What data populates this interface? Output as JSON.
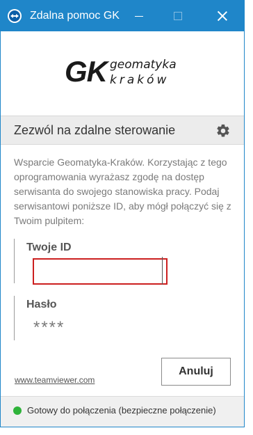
{
  "window": {
    "title": "Zdalna pomoc GK"
  },
  "logo": {
    "mark": "GK",
    "line1": "geomatyka",
    "line2": "kraków"
  },
  "header": {
    "title": "Zezwól na zdalne sterowanie"
  },
  "description": "Wsparcie Geomatyka-Kraków. Korzystając z tego oprogramowania wyrażasz zgodę na dostęp serwisanta do swojego stanowiska pracy. Podaj serwisantowi poniższe ID, aby mógł połączyć się z Twoim pulpitem:",
  "id_field": {
    "label": "Twoje ID",
    "value": ""
  },
  "password_field": {
    "label": "Hasło",
    "value": "****"
  },
  "footer": {
    "link_text": "www.teamviewer.com",
    "cancel_label": "Anuluj"
  },
  "status": {
    "text": "Gotowy do połączenia (bezpieczne połączenie)",
    "indicator_color": "#2fb33a"
  },
  "colors": {
    "titlebar": "#1f86c9",
    "highlight_border": "#cc1f1f"
  },
  "icons": {
    "app": "teamviewer-icon",
    "settings": "gear-icon",
    "minimize": "minimize-icon",
    "maximize": "maximize-icon",
    "close": "close-icon"
  }
}
